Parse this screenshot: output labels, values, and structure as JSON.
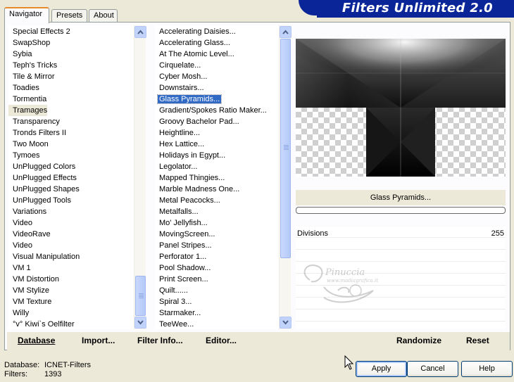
{
  "tabs": [
    {
      "label": "Navigator",
      "active": true
    },
    {
      "label": "Presets",
      "active": false
    },
    {
      "label": "About",
      "active": false
    }
  ],
  "banner": {
    "title": "Filters Unlimited 2.0",
    "color": "#0a2597"
  },
  "categories": {
    "items": [
      "Special Effects 2",
      "SwapShop",
      "Sybia",
      "Teph's Tricks",
      "Tile & Mirror",
      "Toadies",
      "Tormentia",
      "Tramages",
      "Transparency",
      "Tronds Filters II",
      "Two Moon",
      "Tymoes",
      "UnPlugged Colors",
      "UnPlugged Effects",
      "UnPlugged Shapes",
      "UnPlugged Tools",
      "Variations",
      "Video",
      "VideoRave",
      "Video",
      "Visual Manipulation",
      "VM 1",
      "VM Distortion",
      "VM Stylize",
      "VM Texture",
      "Willy",
      "°v° Kiwi`s Oelfilter"
    ],
    "selected": "Tramages"
  },
  "filters": {
    "items": [
      "Accelerating Daisies...",
      "Accelerating Glass...",
      "At The Atomic Level...",
      "Cirquelate...",
      "Cyber Mosh...",
      "Downstairs...",
      "Glass Pyramids...",
      "Gradient/Spokes Ratio Maker...",
      "Groovy Bachelor Pad...",
      "Heightline...",
      "Hex Lattice...",
      "Holidays in Egypt...",
      "Legolator...",
      "Mapped Thingies...",
      "Marble Madness One...",
      "Metal Peacocks...",
      "Metalfalls...",
      "Mo' Jellyfish...",
      "MovingScreen...",
      "Panel Stripes...",
      "Perforator 1...",
      "Pool Shadow...",
      "Print Screen...",
      "Quilt......",
      "Spiral 3...",
      "Starmaker...",
      "TeeWee..."
    ],
    "selected": "Glass Pyramids..."
  },
  "preview": {
    "filter_name": "Glass Pyramids..."
  },
  "params": [
    {
      "label": "Divisions",
      "value": "255"
    }
  ],
  "watermark": {
    "text": "Pinuccia",
    "sub": "www.madiagrafica.it"
  },
  "bottom_bar": {
    "database": "Database",
    "import": "Import...",
    "filter_info": "Filter Info...",
    "editor": "Editor...",
    "randomize": "Randomize",
    "reset": "Reset"
  },
  "status": {
    "database_label": "Database:",
    "database_value": "ICNET-Filters",
    "filters_label": "Filters:",
    "filters_value": "1393"
  },
  "dialog": {
    "apply": "Apply",
    "cancel": "Cancel",
    "help": "Help"
  },
  "colors": {
    "selection": "#316ac5",
    "panel_bg": "#ece9d8",
    "accent_tab": "#e68b2c"
  }
}
